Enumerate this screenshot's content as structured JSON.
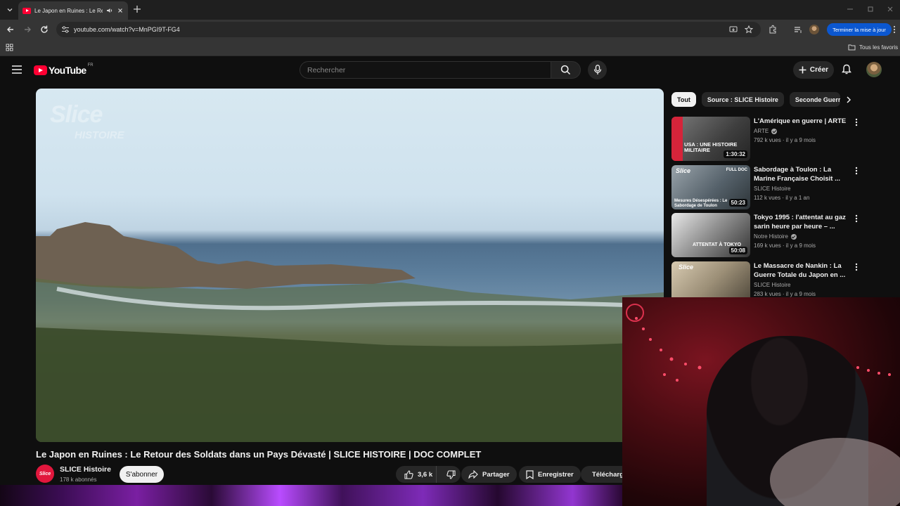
{
  "browser": {
    "tab_title": "Le Japon en Ruines : Le Retour des Soldats dans un Pays Dévasté | SLICE HISTOIRE | DOC COMPLET",
    "url": "youtube.com/watch?v=MnPGI9T-FG4",
    "update_button": "Terminer la mise à jour",
    "bookmarks_folder": "Tous les favoris"
  },
  "header": {
    "logo": "YouTube",
    "country_code": "FR",
    "search_placeholder": "Rechercher",
    "create_label": "Créer"
  },
  "player": {
    "watermark_line1": "Slice",
    "watermark_line2": "HISTOIRE"
  },
  "video": {
    "title": "Le Japon en Ruines : Le Retour des Soldats dans un Pays Dévasté | SLICE HISTOIRE | DOC COMPLET",
    "channel_name": "SLICE Histoire",
    "channel_avatar_text": "Slice",
    "subscribers": "178 k abonnés",
    "subscribe_label": "S'abonner",
    "likes": "3,6 k",
    "share_label": "Partager",
    "save_label": "Enregistrer",
    "download_label": "Télécharger"
  },
  "chips": [
    "Tout",
    "Source : SLICE Histoire",
    "Seconde Guerre mondiale"
  ],
  "recommendations": [
    {
      "title": "L'Amérique en guerre | ARTE",
      "channel": "ARTE",
      "verified": true,
      "meta": "792 k vues · il y a 9 mois",
      "duration": "1:30:32",
      "thumb_text": "USA : UNE HISTOIRE MILITAIRE"
    },
    {
      "title": "Sabordage à Toulon : La Marine Française Choisit ...",
      "channel": "SLICE Histoire",
      "verified": false,
      "meta": "112 k vues · il y a 1 an",
      "duration": "50:23",
      "thumb_text": "Mesures Désespérées : Le Sabordage de Toulon",
      "thumb_logo": "Slice",
      "thumb_badge": "FULL DOC"
    },
    {
      "title": "Tokyo 1995 : l'attentat au gaz sarin heure par heure – ...",
      "channel": "Notre Histoire",
      "verified": true,
      "meta": "169 k vues · il y a 9 mois",
      "duration": "50:08",
      "thumb_text": "ATTENTAT À TOKYO"
    },
    {
      "title": "Le Massacre de Nankin : La Guerre Totale du Japon en ...",
      "channel": "SLICE Histoire",
      "verified": false,
      "meta": "283 k vues · il y a 9 mois",
      "duration": "",
      "thumb_logo": "Slice"
    }
  ],
  "colors": {
    "background": "#0f0f0f",
    "youtube_red": "#ff0033",
    "update_blue": "#0b57d0"
  }
}
